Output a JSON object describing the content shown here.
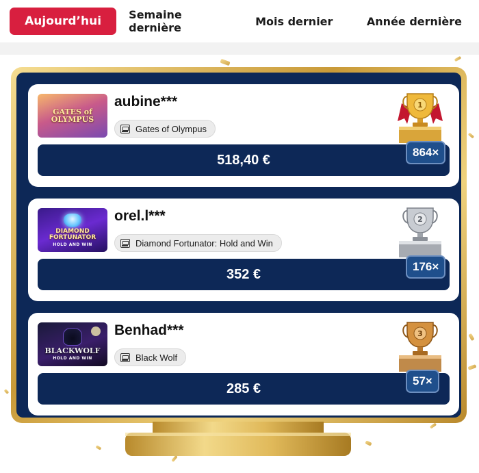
{
  "tabs": [
    {
      "label": "Aujourd’hui",
      "active": true
    },
    {
      "label": "Semaine dernière",
      "active": false
    },
    {
      "label": "Mois dernier",
      "active": false
    },
    {
      "label": "Année dernière",
      "active": false
    }
  ],
  "colors": {
    "active_tab": "#d81f3f",
    "navy": "#0d2857",
    "gold": "#c99a38",
    "multiplier_bg": "#1f4f8c"
  },
  "winners": [
    {
      "rank": 1,
      "trophy": "gold-trophy-icon",
      "trophy_number": "1",
      "username": "aubine***",
      "game": "Gates of Olympus",
      "thumbnail_text": "GATES of OLYMPUS",
      "amount": "518,40 €",
      "multiplier": "864×"
    },
    {
      "rank": 2,
      "trophy": "silver-trophy-icon",
      "trophy_number": "2",
      "username": "orel.l***",
      "game": "Diamond Fortunator: Hold and Win",
      "thumbnail_text": "DIAMOND FORTUNATOR",
      "thumbnail_sub": "HOLD AND WIN",
      "amount": "352 €",
      "multiplier": "176×"
    },
    {
      "rank": 3,
      "trophy": "bronze-trophy-icon",
      "trophy_number": "3",
      "username": "Benhad***",
      "game": "Black Wolf",
      "thumbnail_text": "BLACKWOLF",
      "thumbnail_sub": "HOLD AND WIN",
      "amount": "285 €",
      "multiplier": "57×"
    }
  ]
}
